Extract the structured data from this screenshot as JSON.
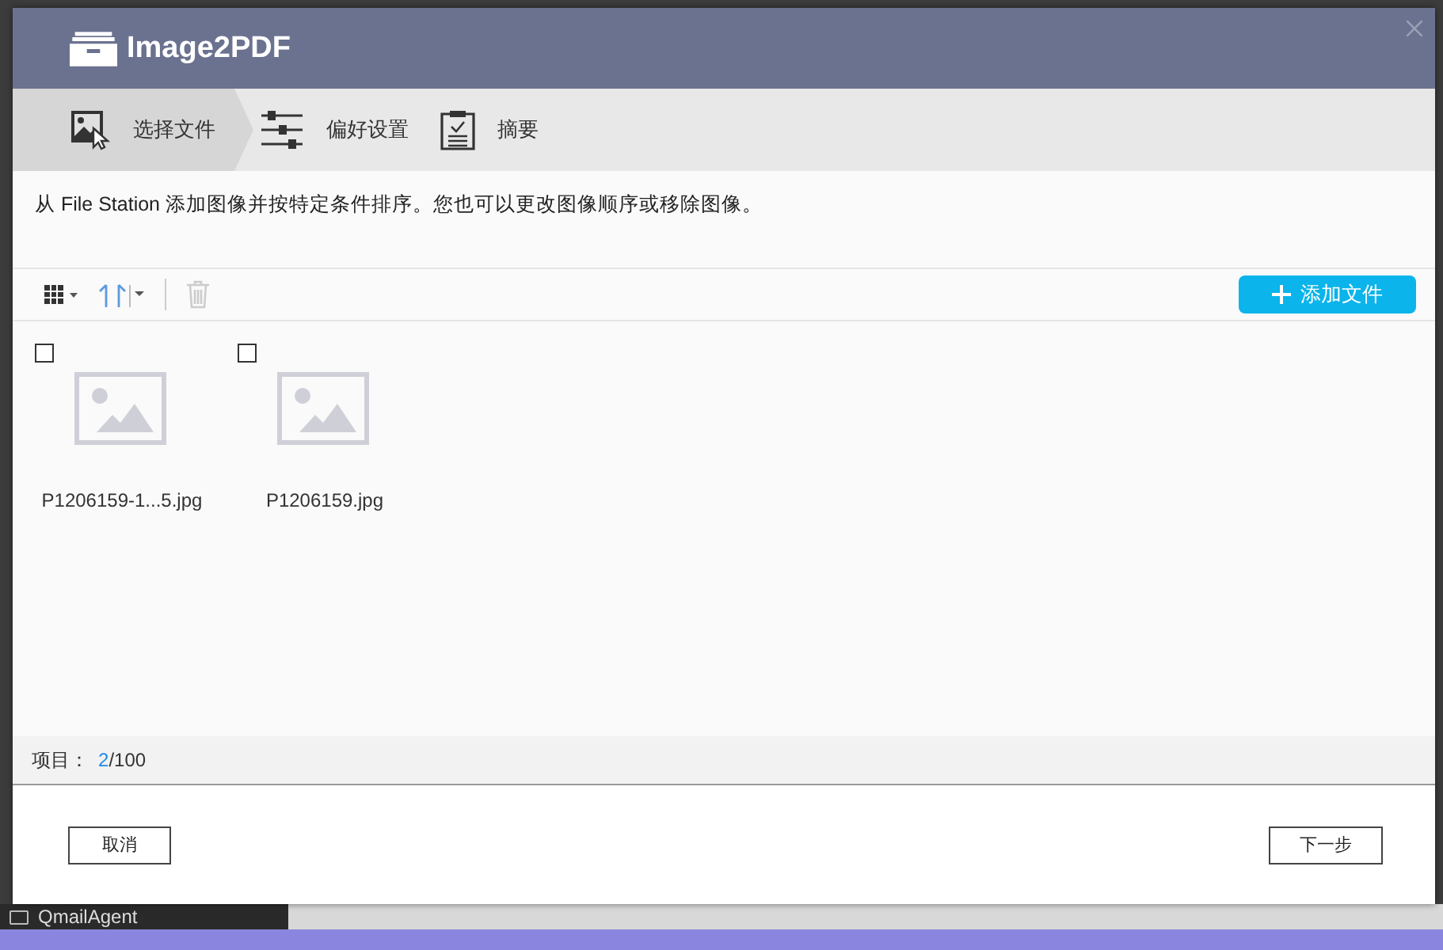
{
  "window": {
    "title": "Image2PDF"
  },
  "steps": [
    {
      "label": "选择文件",
      "selected": true,
      "kind": "files"
    },
    {
      "label": "偏好设置",
      "selected": false,
      "kind": "settings"
    },
    {
      "label": "摘要",
      "selected": false,
      "kind": "summary"
    }
  ],
  "description": "从 File Station 添加图像并按特定条件排序。您也可以更改图像顺序或移除图像。",
  "toolbar": {
    "add_button": "添加文件",
    "delete_disabled": true
  },
  "files": [
    {
      "name": "P1206159-1...5.jpg",
      "checked": false
    },
    {
      "name": "P1206159.jpg",
      "checked": false
    }
  ],
  "status": {
    "label": "项目：",
    "count": "2",
    "total": "/100"
  },
  "buttons": [
    {
      "label": "取消"
    },
    {
      "label": "下一步"
    }
  ],
  "background": {
    "folder": "QmailAgent"
  }
}
